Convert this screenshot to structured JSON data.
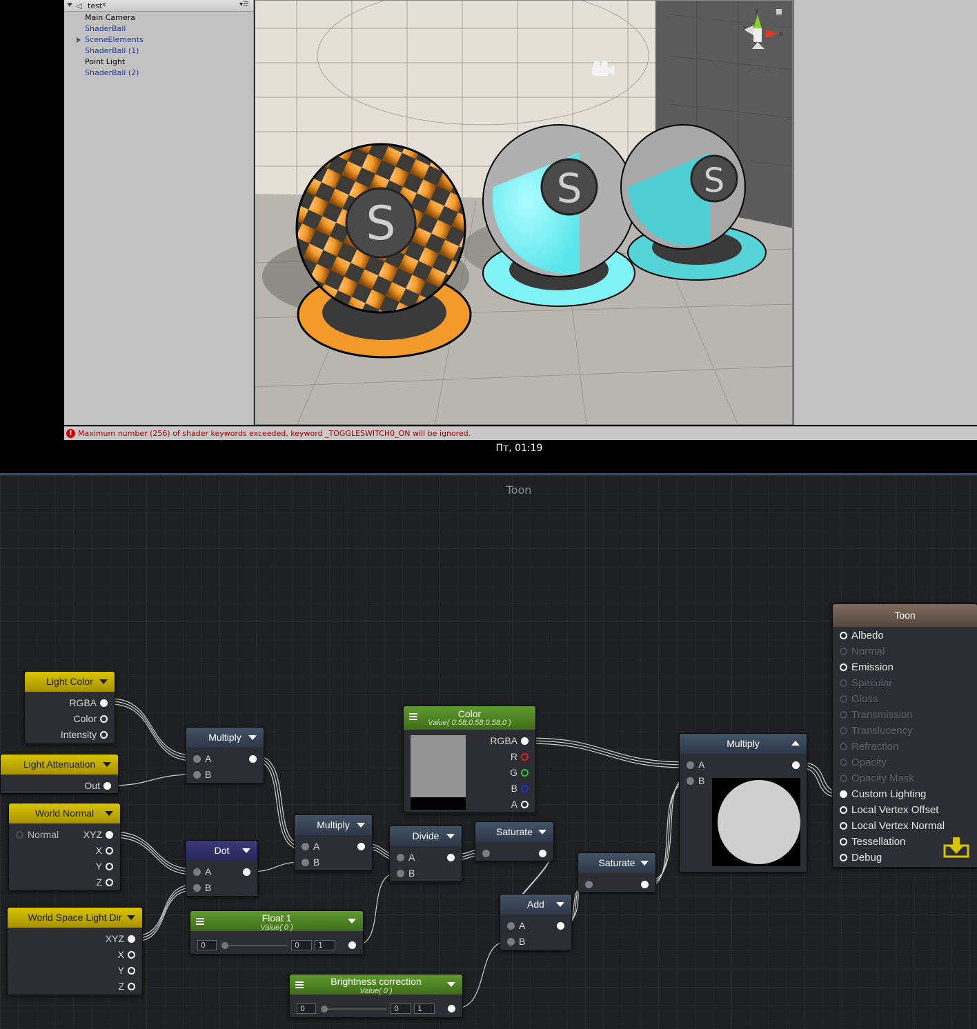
{
  "hierarchy": {
    "scene_name": "test*",
    "items": [
      {
        "label": "Main Camera",
        "prefab": false,
        "foldout": false
      },
      {
        "label": "ShaderBall",
        "prefab": true,
        "foldout": false
      },
      {
        "label": "SceneElements",
        "prefab": true,
        "foldout": true
      },
      {
        "label": "ShaderBall (1)",
        "prefab": true,
        "foldout": false
      },
      {
        "label": "Point Light",
        "prefab": false,
        "foldout": false
      },
      {
        "label": "ShaderBall (2)",
        "prefab": true,
        "foldout": false
      }
    ]
  },
  "scene_view": {
    "projection_label": "Persp",
    "gizmo_axes": {
      "x": "x",
      "y": "y",
      "z": "z"
    },
    "shader_balls": [
      {
        "name": "ShaderBall",
        "color": "#f5a233",
        "pattern": "checker"
      },
      {
        "name": "ShaderBall (1)",
        "color": "#7ff3f5"
      },
      {
        "name": "ShaderBall (2)",
        "color": "#55d3d6"
      }
    ]
  },
  "console": {
    "message": "Maximum number (256) of shader keywords exceeded, keyword _TOGGLESWITCH0_ON will be ignored."
  },
  "taskbar": {
    "clock": "Пт, 01:19"
  },
  "graph": {
    "title": "Toon",
    "nodes": {
      "light_color": {
        "title": "Light Color",
        "outputs": [
          "RGBA",
          "Color",
          "Intensity"
        ]
      },
      "light_attenuation": {
        "title": "Light Attenuation",
        "outputs": [
          "Out"
        ]
      },
      "world_normal": {
        "title": "World Normal",
        "input": "Normal",
        "outputs": [
          "XYZ",
          "X",
          "Y",
          "Z"
        ]
      },
      "world_light_dir": {
        "title": "World Space Light Dir",
        "outputs": [
          "XYZ",
          "X",
          "Y",
          "Z"
        ]
      },
      "multiply1": {
        "title": "Multiply",
        "inputs": [
          "A",
          "B"
        ]
      },
      "dot": {
        "title": "Dot",
        "inputs": [
          "A",
          "B"
        ]
      },
      "multiply2": {
        "title": "Multiply",
        "inputs": [
          "A",
          "B"
        ]
      },
      "float1": {
        "title": "Float 1",
        "subtitle": "Value( 0 )",
        "value": "0",
        "min": "0",
        "max": "1"
      },
      "color": {
        "title": "Color",
        "subtitle": "Value( 0.58,0.58,0.58,0 )",
        "outputs": [
          "RGBA",
          "R",
          "G",
          "B",
          "A"
        ],
        "swatch": "#949494"
      },
      "divide": {
        "title": "Divide",
        "inputs": [
          "A",
          "B"
        ]
      },
      "saturate1": {
        "title": "Saturate"
      },
      "add": {
        "title": "Add",
        "inputs": [
          "A",
          "B"
        ]
      },
      "saturate2": {
        "title": "Saturate"
      },
      "brightness": {
        "title": "Brightness correction",
        "subtitle": "Value( 0 )",
        "value": "0",
        "min": "0",
        "max": "1"
      },
      "multiply3": {
        "title": "Multiply",
        "inputs": [
          "A",
          "B"
        ]
      },
      "toon": {
        "title": "Toon",
        "inputs": [
          {
            "label": "Albedo",
            "enabled": true
          },
          {
            "label": "Normal",
            "enabled": false
          },
          {
            "label": "Emission",
            "enabled": true
          },
          {
            "label": "Specular",
            "enabled": false
          },
          {
            "label": "Gloss",
            "enabled": false
          },
          {
            "label": "Transmission",
            "enabled": false
          },
          {
            "label": "Translucency",
            "enabled": false
          },
          {
            "label": "Refraction",
            "enabled": false
          },
          {
            "label": "Opacity",
            "enabled": false
          },
          {
            "label": "Opacity Mask",
            "enabled": false
          },
          {
            "label": "Custom Lighting",
            "enabled": true
          },
          {
            "label": "Local Vertex Offset",
            "enabled": true
          },
          {
            "label": "Local Vertex Normal",
            "enabled": true
          },
          {
            "label": "Tessellation",
            "enabled": true
          },
          {
            "label": "Debug",
            "enabled": true
          }
        ]
      }
    }
  }
}
